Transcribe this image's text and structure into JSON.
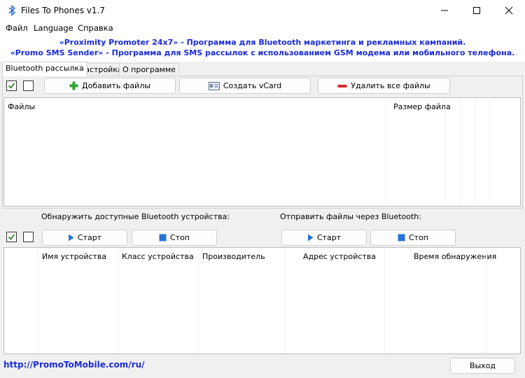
{
  "window": {
    "title": "Files To Phones v1.7",
    "minimize_icon": "minimize-icon",
    "maximize_icon": "maximize-icon",
    "close_icon": "close-icon"
  },
  "menu": [
    "Файл",
    "Language",
    "Справка"
  ],
  "banner": {
    "line1": "«Proximity Promoter 24x7» - Программа для Bluetooth маркетинга и рекламных кампаний.",
    "line2": "«Promo SMS Sender» - Программа для SMS рассылок с использованием GSM модема или мобильного телефона.",
    "color": "#1a2bd8"
  },
  "tabs": [
    "Bluetooth рассылка",
    "Настройка",
    "О программе"
  ],
  "files_toolbar": {
    "add_files": "Добавить файлы",
    "create_vcard": "Создать vCard",
    "delete_all": "Удалить все файлы"
  },
  "files_table": {
    "columns": [
      "Файлы",
      "Размер файла"
    ]
  },
  "discover": {
    "label": "Обнаружить доступные Bluetooth устройства:",
    "start": "Старт",
    "stop": "Стоп"
  },
  "send": {
    "label": "Отправить файлы через Bluetooth:",
    "start": "Старт",
    "stop": "Стоп"
  },
  "devices_table": {
    "columns": [
      "Имя устройства",
      "Класс устройства",
      "Производитель",
      "Адрес устройства",
      "Время обнаружения"
    ]
  },
  "footer": {
    "link": "http://PromoToMobile.com/ru/",
    "exit": "Выход"
  }
}
